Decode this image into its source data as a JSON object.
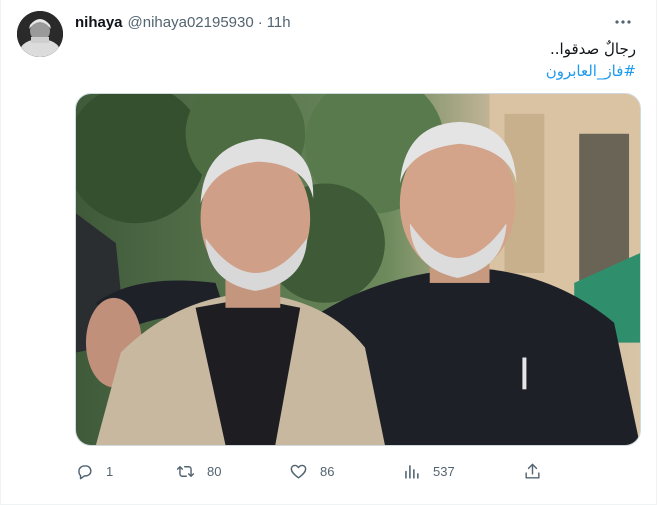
{
  "author": {
    "display_name": "nihaya",
    "handle": "@nihaya02195930",
    "separator": "·",
    "time": "11h"
  },
  "tweet": {
    "text": "رجالٌ صدقوا..",
    "hashtag": "#فاز_العابرون"
  },
  "actions": {
    "reply_count": "1",
    "retweet_count": "80",
    "like_count": "86",
    "views_count": "537"
  },
  "icons": {
    "more": "more-horizontal-icon",
    "reply": "reply-icon",
    "retweet": "retweet-icon",
    "like": "heart-icon",
    "views": "views-chart-icon",
    "share": "share-icon"
  },
  "colors": {
    "link": "#1d9bf0",
    "secondary_text": "#536471"
  }
}
